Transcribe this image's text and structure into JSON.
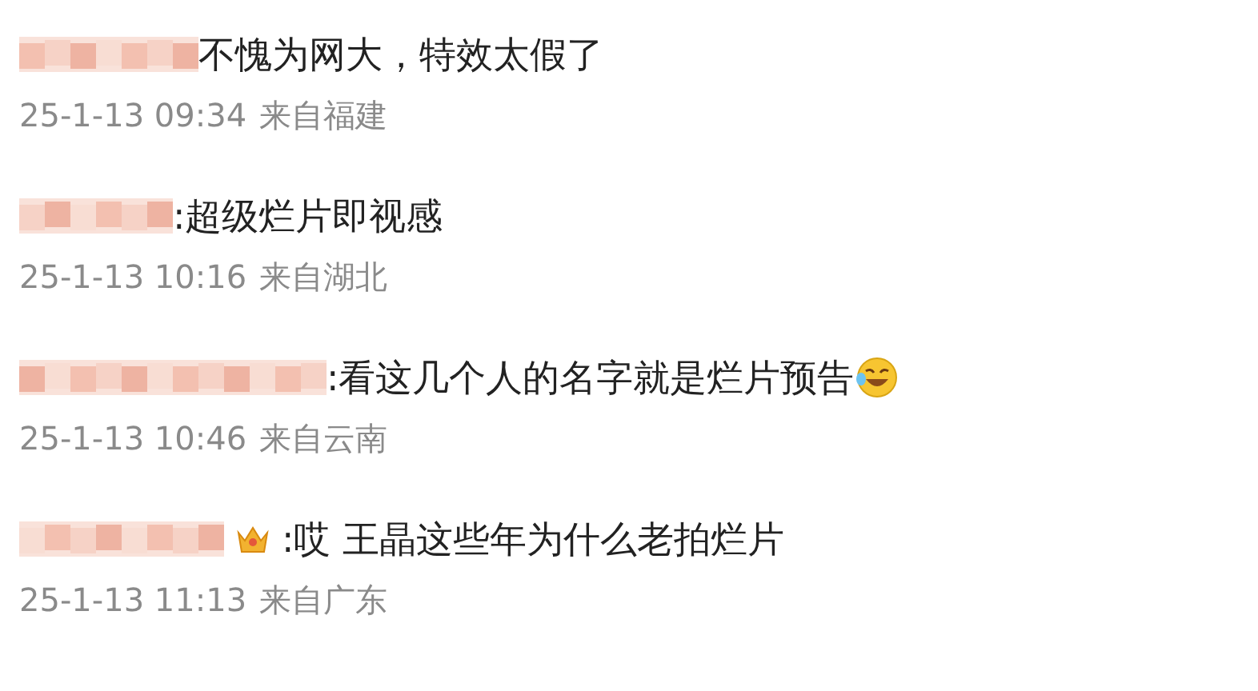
{
  "comments": [
    {
      "text": "不愧为网大，特效太假了",
      "time": "25-1-13 09:34",
      "location": "来自福建",
      "badge": false,
      "trailing_emoji": false
    },
    {
      "text": ":超级烂片即视感",
      "time": "25-1-13 10:16",
      "location": "来自湖北",
      "badge": false,
      "trailing_emoji": false
    },
    {
      "text": ":看这几个人的名字就是烂片预告",
      "time": "25-1-13 10:46",
      "location": "来自云南",
      "badge": false,
      "trailing_emoji": true
    },
    {
      "text": ":哎 王晶这些年为什么老拍烂片",
      "time": "25-1-13 11:13",
      "location": "来自广东",
      "badge": true,
      "trailing_emoji": false
    }
  ]
}
